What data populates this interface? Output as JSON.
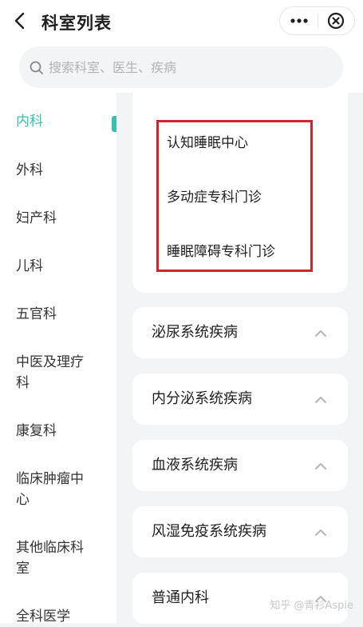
{
  "header": {
    "title": "科室列表",
    "back_icon": "chevron-left-icon",
    "more_icon": "more-icon",
    "close_icon": "close-circle-icon"
  },
  "search": {
    "placeholder": "搜索科室、医生、疾病",
    "value": ""
  },
  "sidebar": {
    "items": [
      {
        "label": "内科",
        "active": true
      },
      {
        "label": "外科"
      },
      {
        "label": "妇产科"
      },
      {
        "label": "儿科"
      },
      {
        "label": "五官科"
      },
      {
        "label": "中医及理疗科"
      },
      {
        "label": "康复科"
      },
      {
        "label": "临床肿瘤中心"
      },
      {
        "label": "其他临床科室"
      },
      {
        "label": "全科医学"
      }
    ]
  },
  "main": {
    "expanded_items": [
      "认知睡眠中心",
      "多动症专科门诊",
      "睡眠障碍专科门诊"
    ],
    "categories": [
      {
        "label": "泌尿系统疾病",
        "icon": "chevron-up-icon"
      },
      {
        "label": "内分泌系统疾病",
        "icon": "chevron-up-icon"
      },
      {
        "label": "血液系统疾病",
        "icon": "chevron-up-icon"
      },
      {
        "label": "风湿免疫系统疾病",
        "icon": "chevron-up-icon"
      },
      {
        "label": "普通内科",
        "icon": "chevron-up-icon"
      }
    ]
  },
  "watermark": "知乎 @青衫Aspie",
  "colors": {
    "accent": "#3bbfad",
    "highlight_border": "#d1232b",
    "background": "#f3f4f6"
  }
}
